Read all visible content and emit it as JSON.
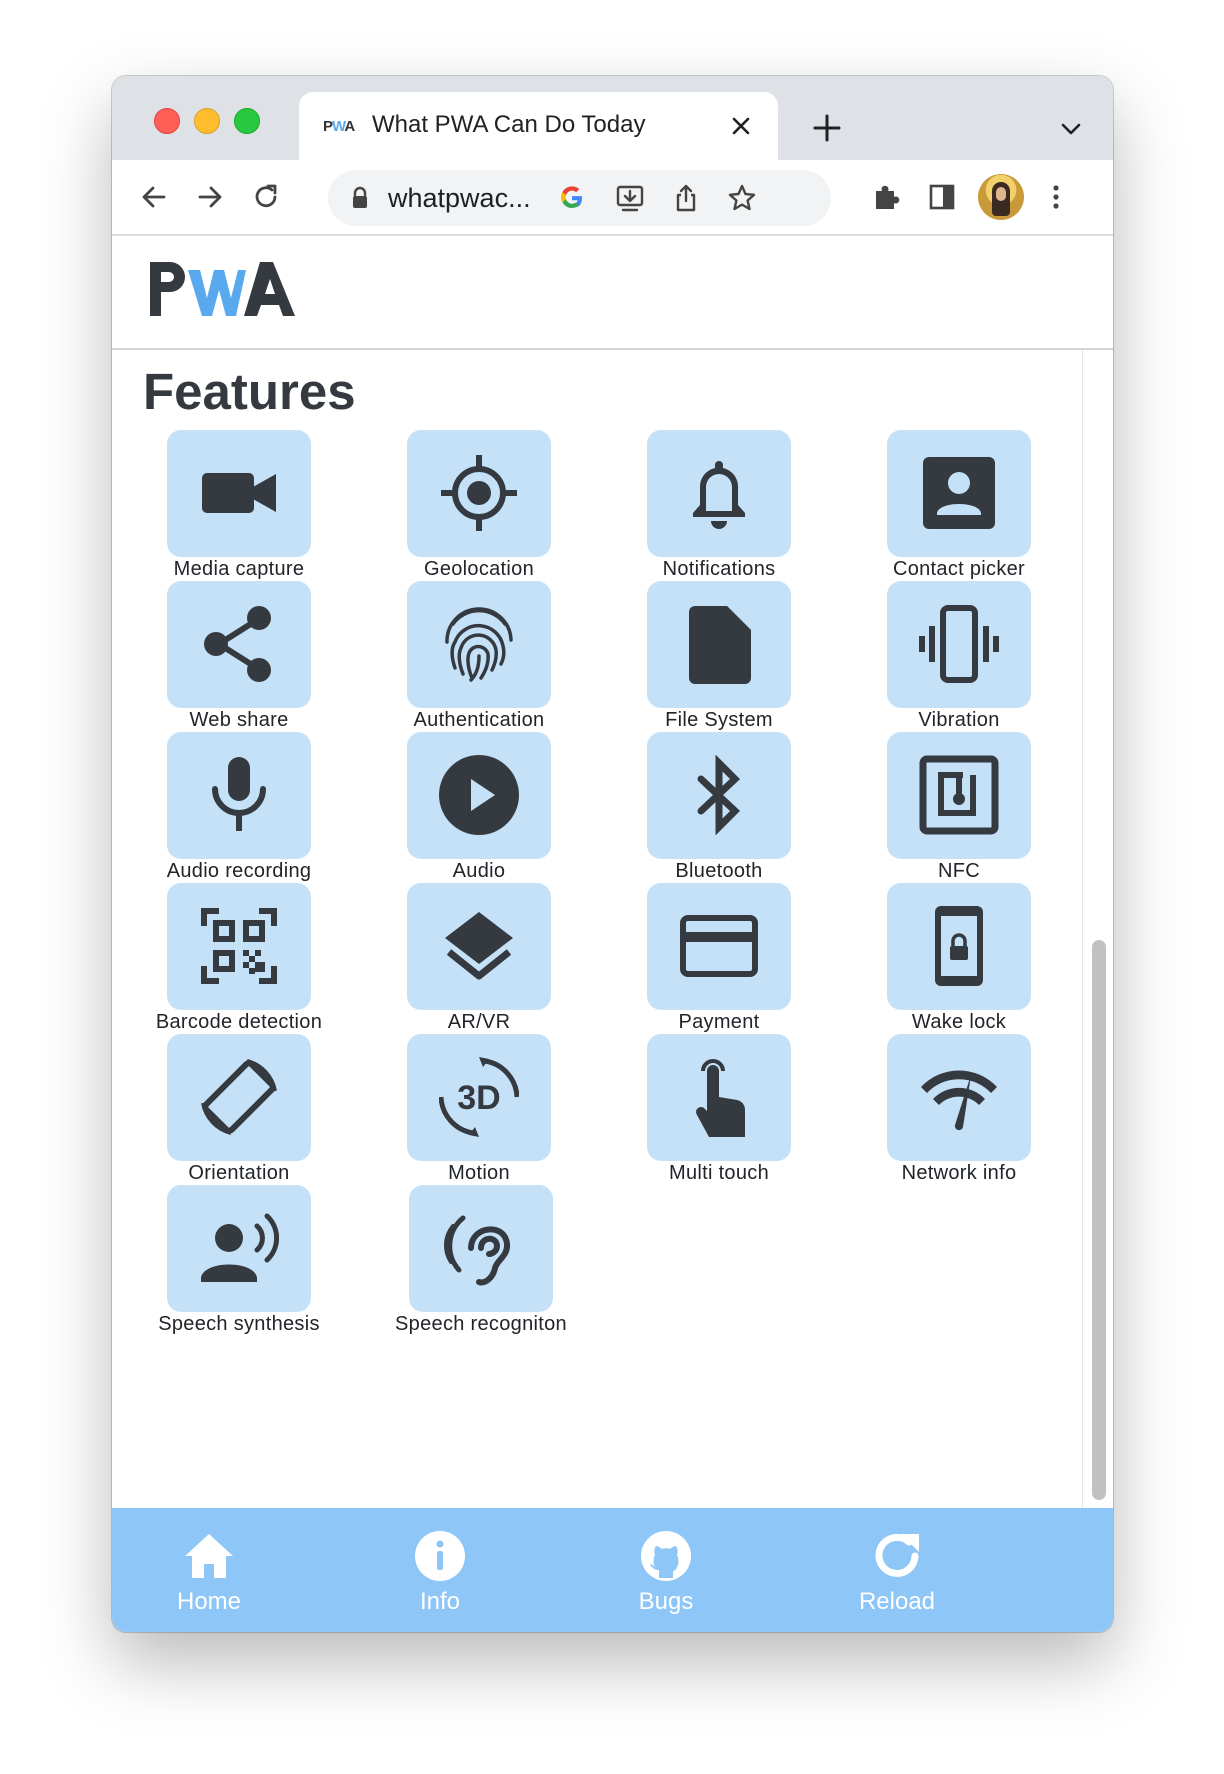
{
  "browser": {
    "tab": {
      "favicon": "PWA",
      "title": "What PWA Can Do Today",
      "close_icon": "close-icon"
    },
    "new_tab_icon": "plus-icon",
    "tab_menu_icon": "chevron-down-icon",
    "toolbar": {
      "back_icon": "arrow-left-icon",
      "forward_icon": "arrow-right-icon",
      "reload_icon": "reload-icon",
      "lock_icon": "lock-icon",
      "url": "whatpwac...",
      "google_icon": "google-icon",
      "install_icon": "install-icon",
      "share_icon": "share-icon",
      "bookmark_icon": "star-icon",
      "extensions_icon": "puzzle-icon",
      "sidepanel_icon": "side-panel-icon",
      "avatar_icon": "profile-avatar",
      "menu_icon": "kebab-menu-icon"
    }
  },
  "page": {
    "logo_text": "PWA",
    "features_title": "Features",
    "features": [
      {
        "label": "Media capture",
        "icon": "video-camera-icon"
      },
      {
        "label": "Geolocation",
        "icon": "gps-target-icon"
      },
      {
        "label": "Notifications",
        "icon": "bell-icon"
      },
      {
        "label": "Contact picker",
        "icon": "contact-icon"
      },
      {
        "label": "Web share",
        "icon": "share-nodes-icon"
      },
      {
        "label": "Authentication",
        "icon": "fingerprint-icon"
      },
      {
        "label": "File System",
        "icon": "file-icon"
      },
      {
        "label": "Vibration",
        "icon": "vibration-icon"
      },
      {
        "label": "Audio recording",
        "icon": "microphone-icon"
      },
      {
        "label": "Audio",
        "icon": "play-circle-icon"
      },
      {
        "label": "Bluetooth",
        "icon": "bluetooth-icon"
      },
      {
        "label": "NFC",
        "icon": "nfc-icon"
      },
      {
        "label": "Barcode detection",
        "icon": "qr-code-icon"
      },
      {
        "label": "AR/VR",
        "icon": "layers-icon"
      },
      {
        "label": "Payment",
        "icon": "credit-card-icon"
      },
      {
        "label": "Wake lock",
        "icon": "phone-lock-icon"
      },
      {
        "label": "Orientation",
        "icon": "screen-rotation-icon"
      },
      {
        "label": "Motion",
        "icon": "3d-rotation-icon"
      },
      {
        "label": "Multi touch",
        "icon": "touch-hand-icon"
      },
      {
        "label": "Network info",
        "icon": "wifi-speed-icon"
      },
      {
        "label": "Speech synthesis",
        "icon": "speaker-person-icon"
      },
      {
        "label": "Speech recogniton",
        "icon": "ear-icon"
      }
    ],
    "bottom_nav": [
      {
        "label": "Home",
        "icon": "home-icon"
      },
      {
        "label": "Info",
        "icon": "info-icon"
      },
      {
        "label": "Bugs",
        "icon": "github-icon"
      },
      {
        "label": "Reload",
        "icon": "refresh-icon"
      }
    ]
  },
  "colors": {
    "tile_bg": "#c5e1f8",
    "icon_fill": "#343a40",
    "bottom_nav_bg": "#8ec7f7",
    "logo_accent": "#5aa9ef"
  }
}
